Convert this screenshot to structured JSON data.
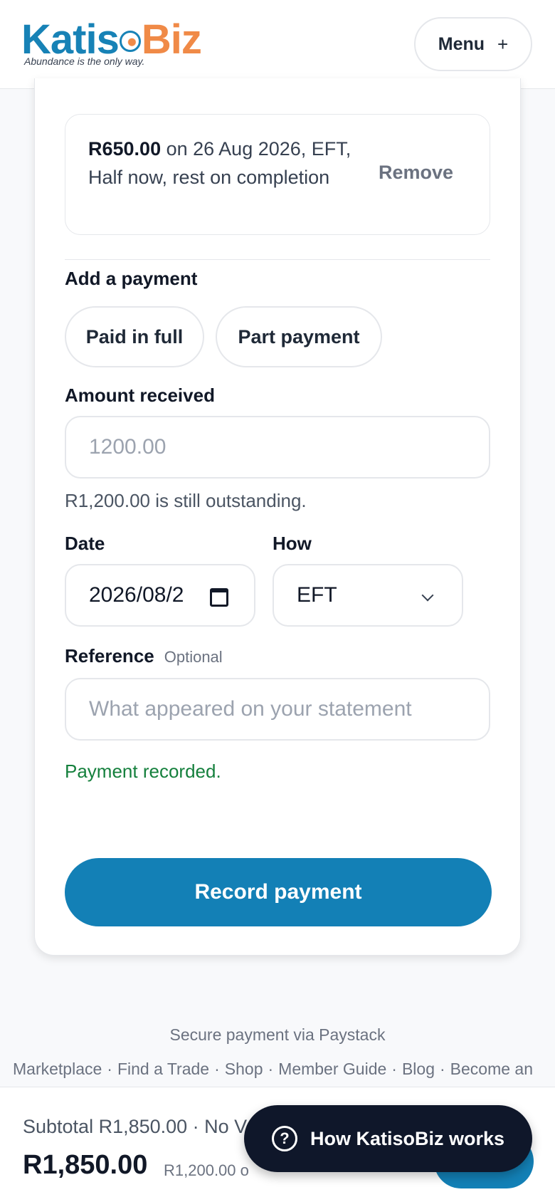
{
  "header": {
    "logo_katiso": "Katis",
    "logo_biz": "Biz",
    "logo_tagline": "Abundance is the only way.",
    "menu_label": "Menu",
    "menu_icon": "+"
  },
  "payment_entry": {
    "amount": "R650.00",
    "details": " on 26 Aug 2026, EFT, Half now, rest on completion",
    "remove_label": "Remove"
  },
  "form": {
    "add_payment_label": "Add a payment",
    "paid_in_full_label": "Paid in full",
    "part_payment_label": "Part payment",
    "amount_label": "Amount received",
    "amount_value": "1200.00",
    "outstanding_text": "R1,200.00 is still outstanding.",
    "date_label": "Date",
    "date_value": "2026/08/2",
    "how_label": "How",
    "how_value": "EFT",
    "reference_label": "Reference",
    "reference_optional": "Optional",
    "reference_placeholder": "What appeared on your statement",
    "success_text": "Payment recorded.",
    "record_button": "Record payment"
  },
  "footer": {
    "secure_text": "Secure payment via Paystack",
    "links": [
      "Marketplace",
      "Find a Trade",
      "Shop",
      "Member Guide",
      "Blog",
      "Become an"
    ]
  },
  "bottom_bar": {
    "subtotal": "Subtotal R1,850.00 · No V",
    "total": "R1,850.00",
    "outstanding": "R1,200.00 o"
  },
  "help_button": {
    "icon": "?",
    "label": "How KatisoBiz works"
  },
  "colors": {
    "brand_blue": "#1380b6",
    "brand_orange": "#f08a47",
    "success_green": "#15803d",
    "dark_navy": "#0f172a"
  }
}
